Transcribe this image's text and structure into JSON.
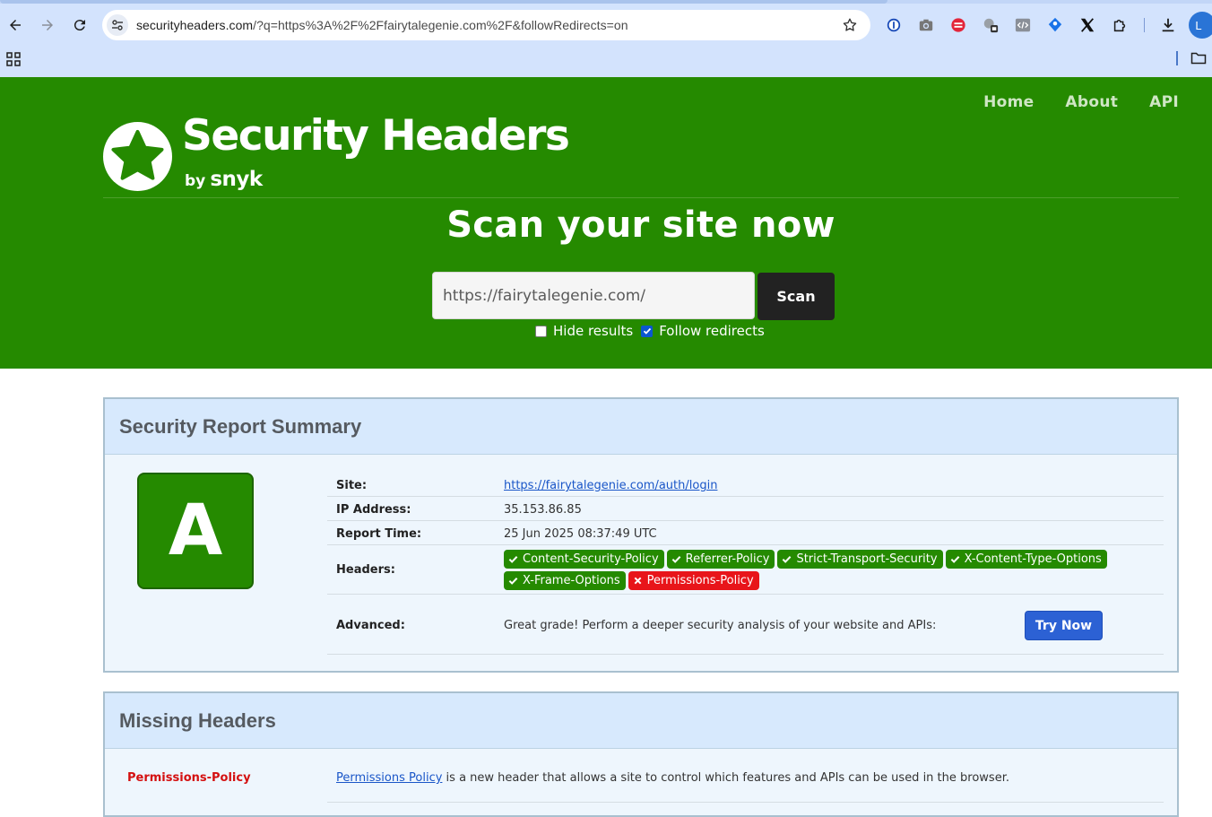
{
  "browser": {
    "url_host": "securityheaders.com",
    "url_rest": "/?q=https%3A%2F%2Ffairytalegenie.com%2F&followRedirects=on",
    "profile_initial": "L",
    "extension_icons": [
      "password-manager-icon",
      "camera-icon",
      "red-extension-icon",
      "ai-extension-icon",
      "code-icon",
      "blue-tag-icon",
      "x-icon",
      "puzzle-icon",
      "download-icon"
    ]
  },
  "site": {
    "nav": [
      "Home",
      "About",
      "API"
    ],
    "logo": {
      "title": "Security Headers",
      "by": "by",
      "brand": "snyk"
    },
    "scan": {
      "title": "Scan your site now",
      "input_value": "https://fairytalegenie.com/",
      "button": "Scan",
      "hide_results_label": "Hide results",
      "hide_results_checked": false,
      "follow_redirects_label": "Follow redirects",
      "follow_redirects_checked": true
    }
  },
  "summary": {
    "title": "Security Report Summary",
    "grade": "A",
    "grade_color": "#258a00",
    "rows": {
      "site_label": "Site:",
      "site_value": "https://fairytalegenie.com/auth/login",
      "ip_label": "IP Address:",
      "ip_value": "35.153.86.85",
      "time_label": "Report Time:",
      "time_value": "25 Jun 2025 08:37:49 UTC",
      "headers_label": "Headers:",
      "advanced_label": "Advanced:",
      "advanced_text": "Great grade! Perform a deeper security analysis of your website and APIs:",
      "try_now": "Try Now"
    },
    "headers": [
      {
        "name": "Content-Security-Policy",
        "present": true
      },
      {
        "name": "Referrer-Policy",
        "present": true
      },
      {
        "name": "Strict-Transport-Security",
        "present": true
      },
      {
        "name": "X-Content-Type-Options",
        "present": true
      },
      {
        "name": "X-Frame-Options",
        "present": true
      },
      {
        "name": "Permissions-Policy",
        "present": false
      }
    ]
  },
  "missing": {
    "title": "Missing Headers",
    "items": [
      {
        "name": "Permissions-Policy",
        "link_text": "Permissions Policy",
        "description": " is a new header that allows a site to control which features and APIs can be used in the browser."
      }
    ]
  }
}
